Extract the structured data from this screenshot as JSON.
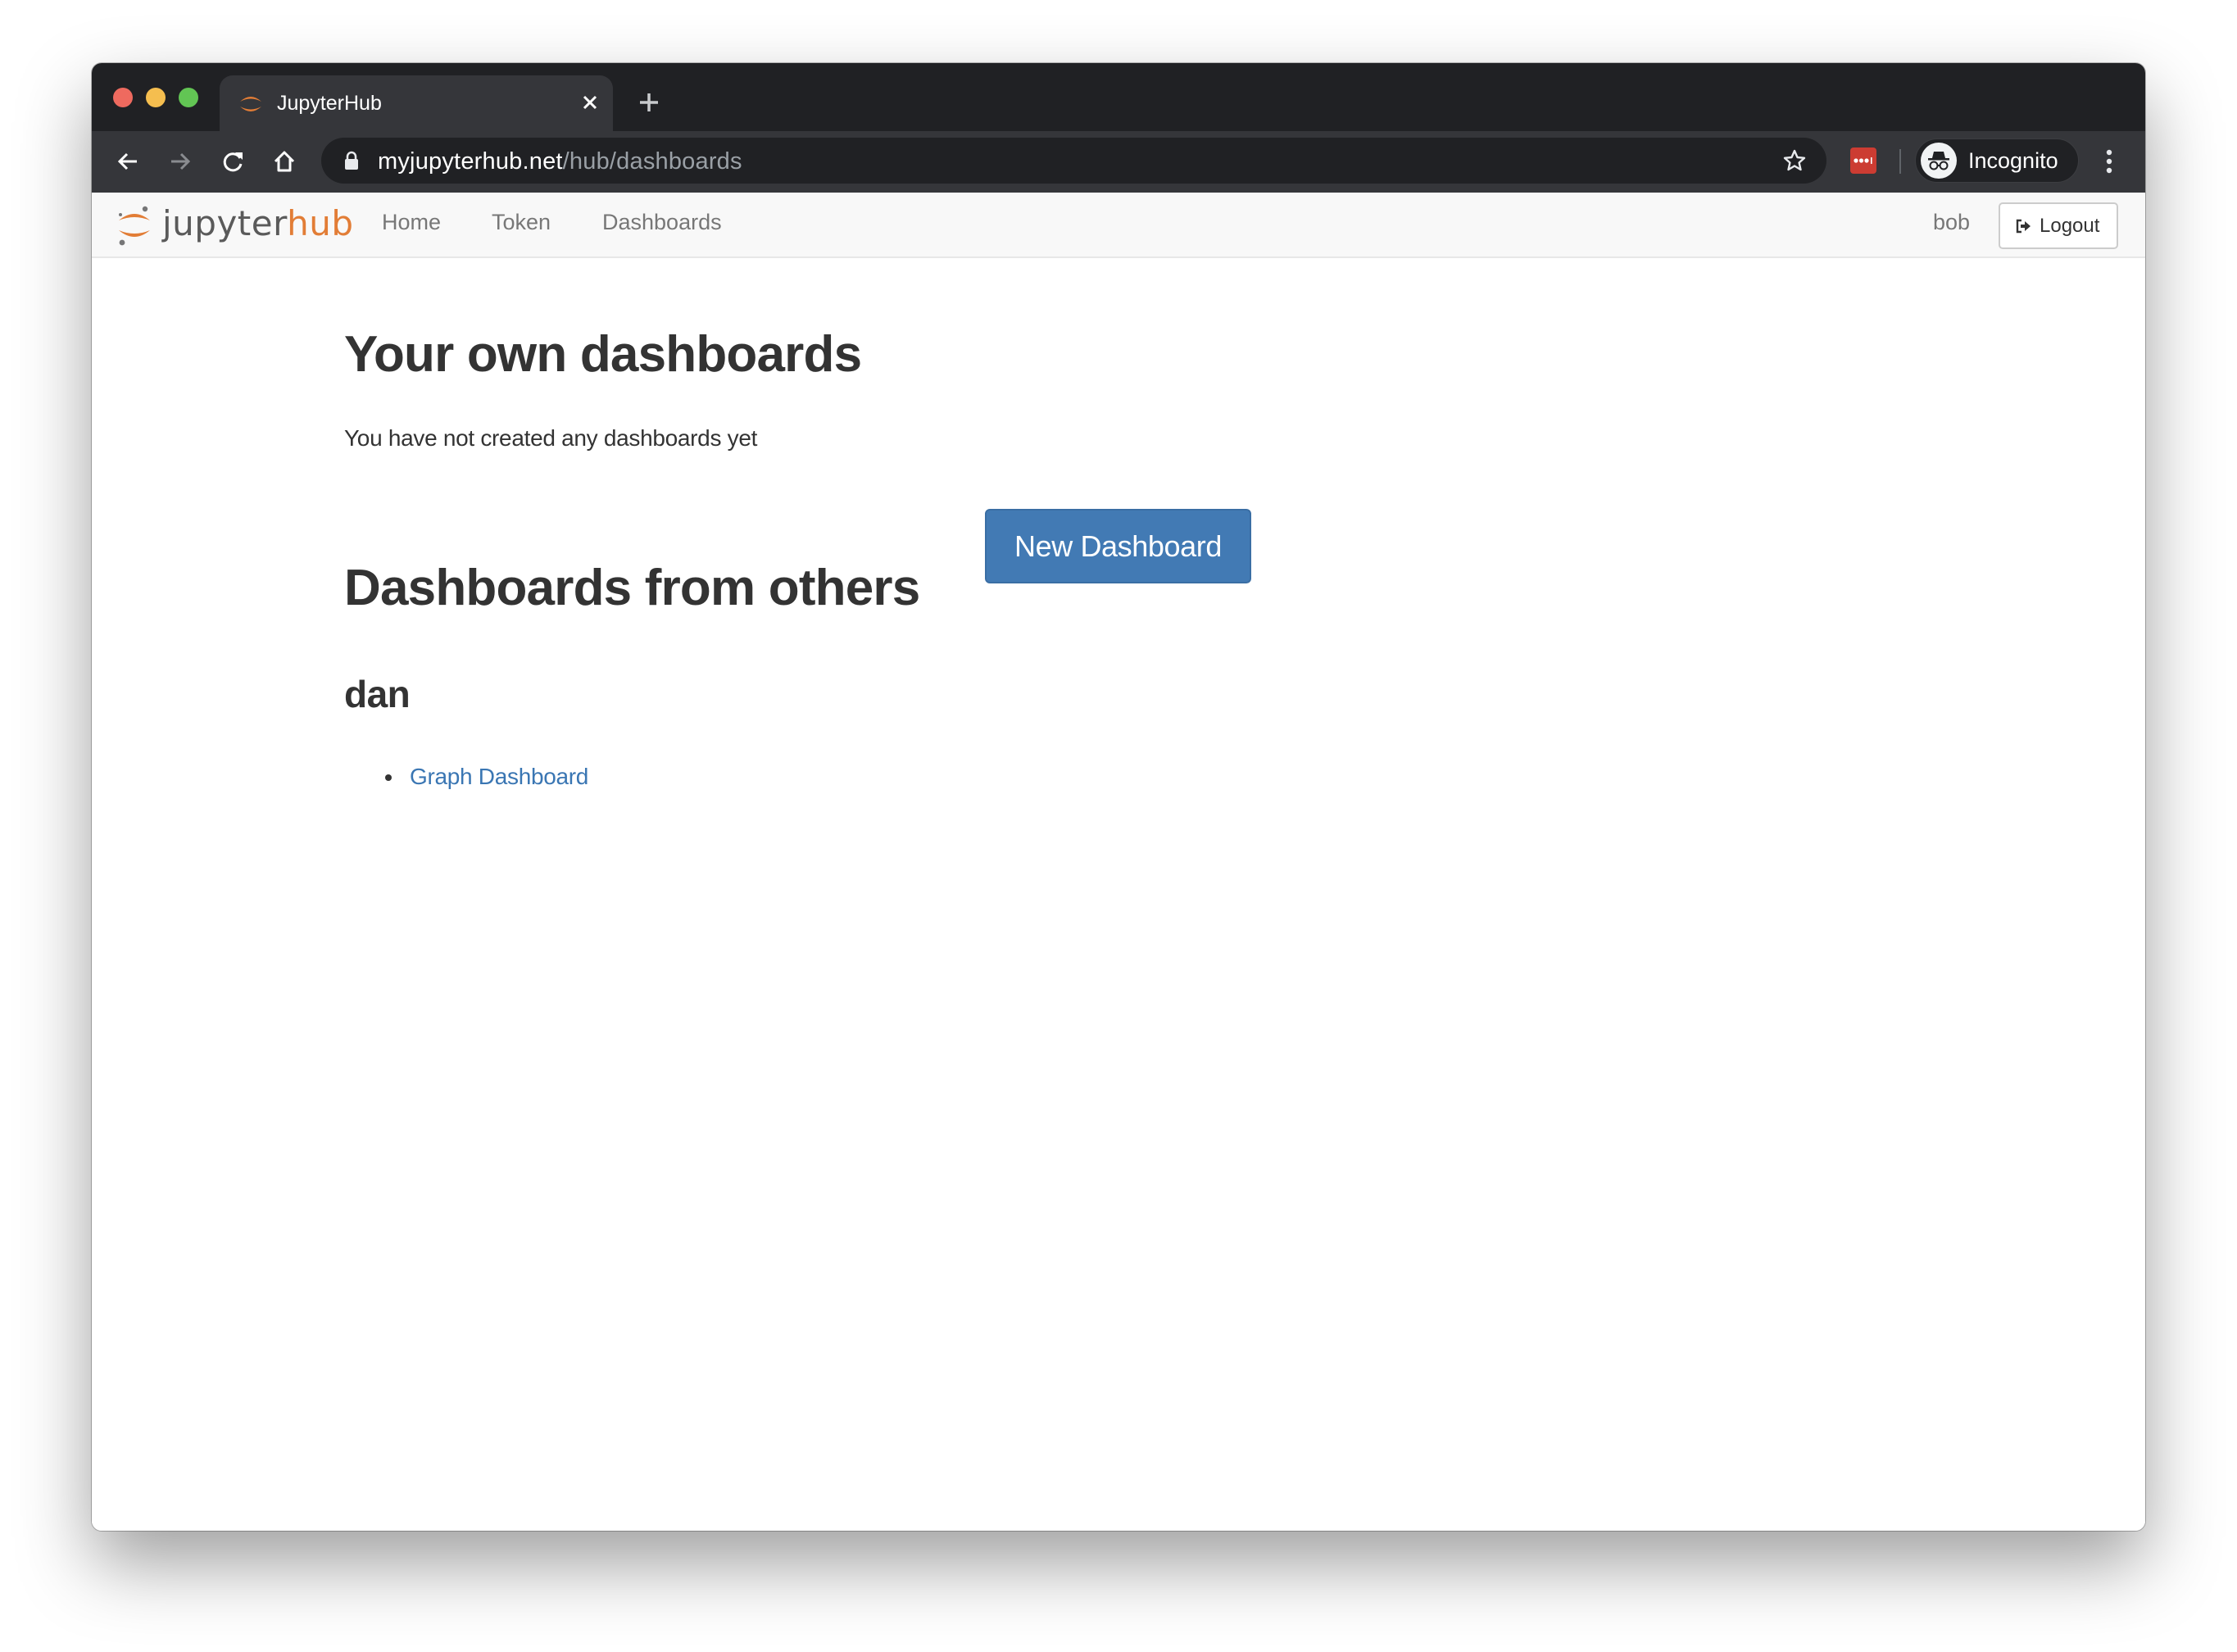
{
  "browser": {
    "tab": {
      "title": "JupyterHub",
      "favicon": "jupyter-logo-icon",
      "close_icon": "close-icon"
    },
    "new_tab_icon": "plus-icon",
    "toolbar": {
      "back_icon": "arrow-left-icon",
      "forward_icon": "arrow-right-icon",
      "reload_icon": "reload-icon",
      "home_icon": "home-icon",
      "url": {
        "host": "myjupyterhub.net",
        "path": "/hub/dashboards"
      },
      "lock_icon": "lock-icon",
      "bookmark_icon": "star-icon",
      "extension_icon": "lastpass-icon",
      "profile": {
        "label": "Incognito",
        "icon": "incognito-icon"
      },
      "menu_icon": "kebab-menu-icon"
    }
  },
  "navbar": {
    "logo": {
      "part1": "jupyter",
      "part2": "hub"
    },
    "links": [
      {
        "label": "Home"
      },
      {
        "label": "Token"
      },
      {
        "label": "Dashboards"
      }
    ],
    "user": "bob",
    "logout_label": "Logout",
    "logout_icon": "sign-out-icon"
  },
  "main": {
    "own_heading": "Your own dashboards",
    "empty_message": "You have not created any dashboards yet",
    "new_button_label": "New Dashboard",
    "others_heading": "Dashboards from others",
    "groups": [
      {
        "owner": "dan",
        "dashboards": [
          {
            "title": "Graph Dashboard"
          }
        ]
      }
    ]
  },
  "colors": {
    "brand_orange": "#e27d36",
    "primary_button": "#427ab4",
    "link": "#3a76b3",
    "browser_frame": "#202124",
    "browser_toolbar": "#35363a"
  }
}
